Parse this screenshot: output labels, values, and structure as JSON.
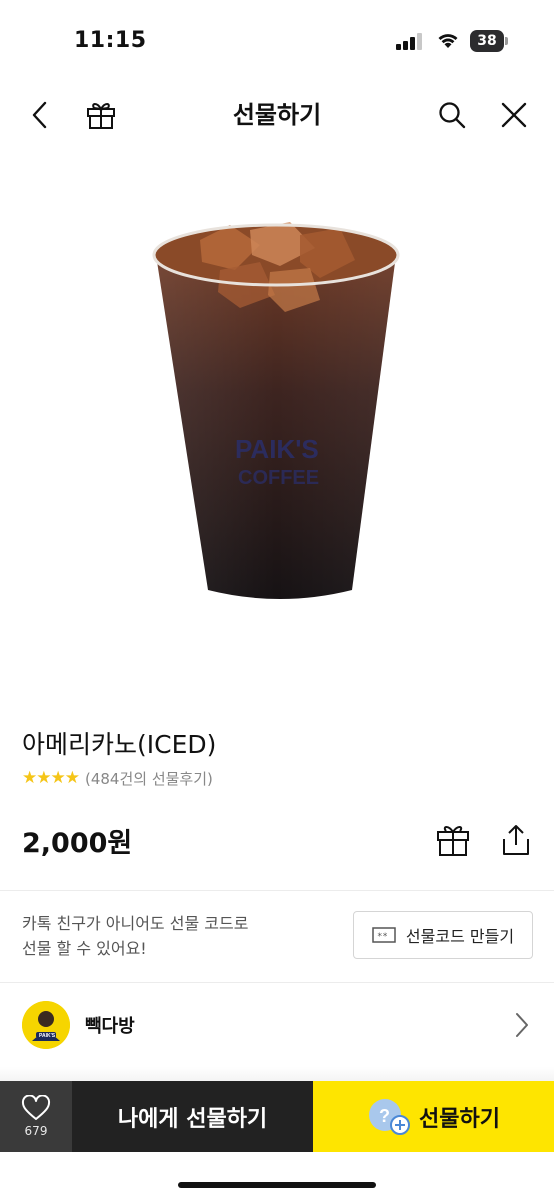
{
  "status_bar": {
    "time": "11:15",
    "battery_level": "38"
  },
  "nav": {
    "title": "선물하기",
    "icons": [
      "chevron-left-icon",
      "gift-icon",
      "search-icon",
      "close-icon"
    ]
  },
  "product": {
    "image": "iced-americano-cup",
    "name": "아메리카노(ICED)",
    "rating_stars": 4,
    "rating_text": "(484건의 선물후기)",
    "price": "2,000원",
    "price_icons": [
      "gift-box-icon",
      "share-icon"
    ]
  },
  "gift_code": {
    "text_line1": "카톡 친구가 아니어도 선물 코드로",
    "text_line2": "선물 할 수 있어요!",
    "button_label": "선물코드 만들기"
  },
  "brand": {
    "name": "빽다방",
    "logo_text": "PAIK'S"
  },
  "bottom_bar": {
    "like_count": "679",
    "gift_self_label": "나에게 선물하기",
    "gift_label": "선물하기"
  },
  "colors": {
    "kakao_yellow": "#fee500",
    "dark_button": "#222222",
    "like_bg": "#3a3a3a",
    "star": "#f5c518"
  }
}
